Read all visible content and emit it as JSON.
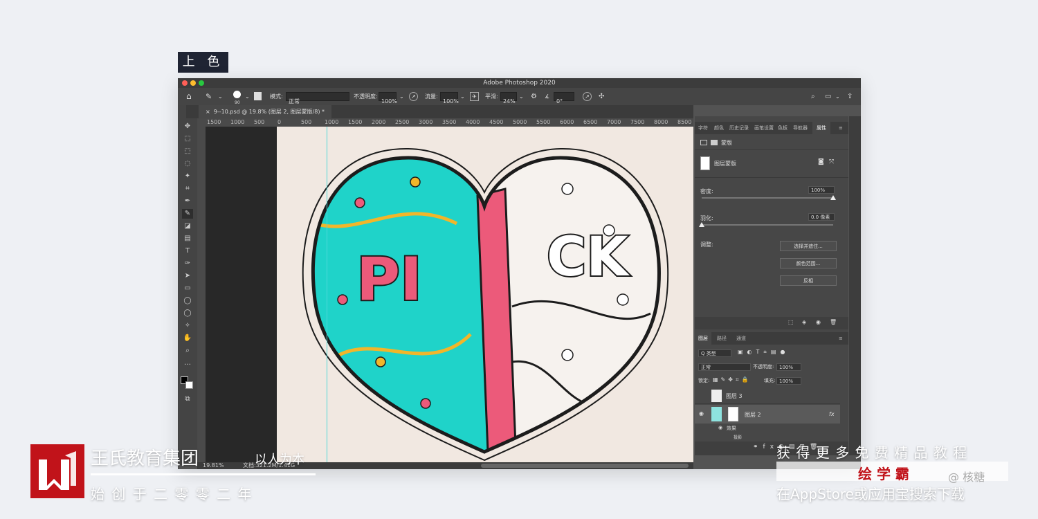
{
  "badge": {
    "label": "上 色"
  },
  "app": {
    "title": "Adobe Photoshop 2020"
  },
  "options": {
    "brush_size": "90",
    "mode_label": "模式:",
    "mode_value": "正常",
    "opacity_label": "不透明度:",
    "opacity_value": "100%",
    "flow_label": "流量:",
    "flow_value": "100%",
    "smooth_label": "平滑:",
    "smooth_value": "24%",
    "angle_value": "0°"
  },
  "document": {
    "tab_label": "9--10.psd @ 19.8% (图层 2, 图层蒙版/8) *"
  },
  "ruler": {
    "labels": [
      "1500",
      "1000",
      "500",
      "0",
      "500",
      "1000",
      "1500",
      "2000",
      "2500",
      "3000",
      "3500",
      "4000",
      "4500",
      "5000",
      "5500",
      "6000",
      "6500",
      "7000",
      "7500",
      "8000",
      "8500"
    ]
  },
  "status": {
    "zoom": "19.81%",
    "doc_size": "文档:321.2M/1.41G"
  },
  "artwork": {
    "text_left": "PI",
    "text_right": "CK"
  },
  "colors": {
    "teal": "#1fd3c9",
    "pink": "#ec5a7a",
    "yellow": "#f2b62a",
    "ink": "#1c1c1c",
    "paper": "#f1e8e1"
  },
  "properties_panel": {
    "tabs": [
      "字符",
      "颜色",
      "历史记录",
      "画笔设置",
      "色板",
      "导航器",
      "属性"
    ],
    "active_tab": "属性",
    "section_label": "蒙版",
    "mask_label": "图层蒙版",
    "density_label": "密度:",
    "density_value": "100%",
    "feather_label": "羽化:",
    "feather_value": "0.0 像素",
    "adjust_label": "调整:",
    "buttons": [
      "选择并遮住...",
      "颜色范围...",
      "反相"
    ]
  },
  "layers_panel": {
    "tabs": [
      "图层",
      "路径",
      "通道"
    ],
    "filter_label": "Q 类型",
    "blend_mode": "正常",
    "opacity_label": "不透明度:",
    "opacity_value": "100%",
    "lock_label": "锁定:",
    "fill_label": "填充:",
    "fill_value": "100%",
    "layers": [
      {
        "name": "图层 3"
      },
      {
        "name": "图层 2",
        "fx": "fx"
      }
    ],
    "effects_label": "效果",
    "effect_item": "投影"
  },
  "watermark": {
    "company": "王氏教育集团",
    "motto": "以人为本",
    "founded": "始 创 于 二 零 零 二 年",
    "promo_line1": "获 得 更 多 免 费 精 品 教 程",
    "promo_app": "绘 学 霸",
    "promo_author": "@ 核糖",
    "promo_line3": "在AppStore或应用宝搜索下载"
  }
}
